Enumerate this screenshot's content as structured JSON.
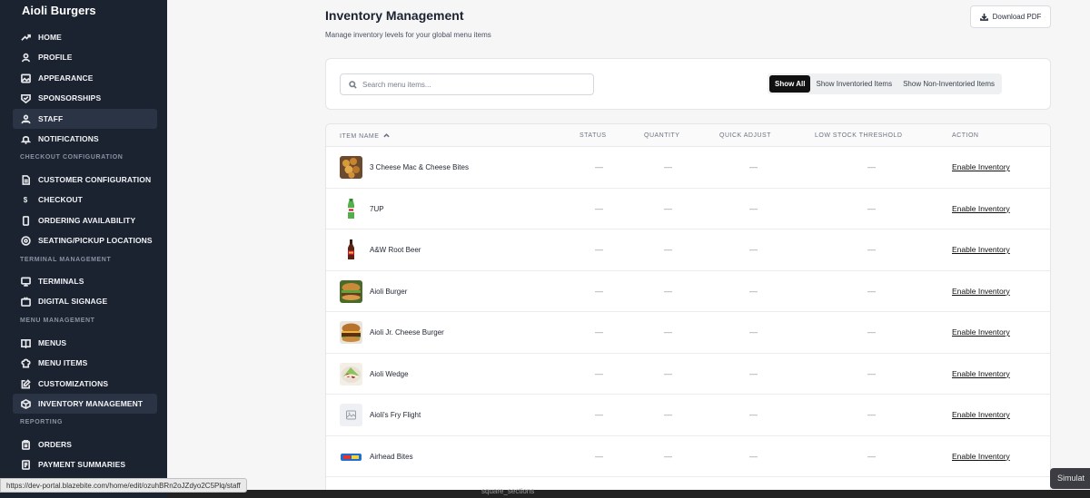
{
  "sidebar": {
    "brand": "Aioli Burgers",
    "items": [
      {
        "label": "HOME",
        "icon": "trend-icon"
      },
      {
        "label": "PROFILE",
        "icon": "user-icon"
      },
      {
        "label": "APPEARANCE",
        "icon": "image-icon"
      },
      {
        "label": "SPONSORSHIPS",
        "icon": "badge-icon"
      },
      {
        "label": "STAFF",
        "icon": "users-icon"
      },
      {
        "label": "NOTIFICATIONS",
        "icon": "bell-icon"
      },
      {
        "label": "CUSTOMER CONFIGURATION",
        "icon": "file-icon"
      },
      {
        "label": "CHECKOUT",
        "icon": "dollar-icon"
      },
      {
        "label": "ORDERING AVAILABILITY",
        "icon": "phone-icon"
      },
      {
        "label": "SEATING/PICKUP LOCATIONS",
        "icon": "location-icon"
      },
      {
        "label": "TERMINALS",
        "icon": "monitor-icon"
      },
      {
        "label": "DIGITAL SIGNAGE",
        "icon": "tv-icon"
      },
      {
        "label": "MENUS",
        "icon": "book-icon"
      },
      {
        "label": "MENU ITEMS",
        "icon": "chef-hat-icon"
      },
      {
        "label": "CUSTOMIZATIONS",
        "icon": "edit-icon"
      },
      {
        "label": "INVENTORY MANAGEMENT",
        "icon": "box-icon"
      },
      {
        "label": "ORDERS",
        "icon": "clipboard-icon"
      },
      {
        "label": "PAYMENT SUMMARIES",
        "icon": "receipt-icon"
      }
    ],
    "active_index": 4,
    "highlight_index": 15,
    "sections": {
      "checkout": "CHECKOUT CONFIGURATION",
      "terminal": "TERMINAL MANAGEMENT",
      "menu": "MENU MANAGEMENT",
      "reporting": "REPORTING"
    }
  },
  "header": {
    "title": "Inventory Management",
    "subtitle": "Manage inventory levels for your global menu items",
    "download_label": "Download PDF"
  },
  "filters": {
    "search_placeholder": "Search menu items...",
    "search_value": "",
    "tabs": [
      "Show All",
      "Show Inventoried Items",
      "Show Non-Inventoried Items"
    ],
    "active_tab": 0
  },
  "table": {
    "columns": [
      "ITEM NAME",
      "STATUS",
      "QUANTITY",
      "QUICK ADJUST",
      "LOW STOCK THRESHOLD",
      "ACTION"
    ],
    "rows": [
      {
        "name": "3 Cheese Mac & Cheese Bites",
        "status": "—",
        "quantity": "—",
        "quick_adjust": "—",
        "threshold": "—",
        "action": "Enable Inventory",
        "thumb": "mac-cheese-photo"
      },
      {
        "name": "7UP",
        "status": "—",
        "quantity": "—",
        "quick_adjust": "—",
        "threshold": "—",
        "action": "Enable Inventory",
        "thumb": "soda-bottle-photo"
      },
      {
        "name": "A&W Root Beer",
        "status": "—",
        "quantity": "—",
        "quick_adjust": "—",
        "threshold": "—",
        "action": "Enable Inventory",
        "thumb": "root-beer-bottle-photo"
      },
      {
        "name": "Aioli Burger",
        "status": "—",
        "quantity": "—",
        "quick_adjust": "—",
        "threshold": "—",
        "action": "Enable Inventory",
        "thumb": "burger-photo"
      },
      {
        "name": "Aioli Jr. Cheese Burger",
        "status": "—",
        "quantity": "—",
        "quick_adjust": "—",
        "threshold": "—",
        "action": "Enable Inventory",
        "thumb": "cheeseburger-photo"
      },
      {
        "name": "Aioli Wedge",
        "status": "—",
        "quantity": "—",
        "quick_adjust": "—",
        "threshold": "—",
        "action": "Enable Inventory",
        "thumb": "wedge-salad-photo"
      },
      {
        "name": "Aioli's Fry Flight",
        "status": "—",
        "quantity": "—",
        "quick_adjust": "—",
        "threshold": "—",
        "action": "Enable Inventory",
        "thumb": "image-placeholder-icon"
      },
      {
        "name": "Airhead Bites",
        "status": "—",
        "quantity": "—",
        "quick_adjust": "—",
        "threshold": "—",
        "action": "Enable Inventory",
        "thumb": "candy-bag-photo"
      }
    ]
  },
  "statusbar": {
    "url": "https://dev-portal.blazebite.com/home/edit/ozuhBRn2oJZdyo2C5Plq/staff"
  },
  "footer": {
    "partial_text": "square_sections",
    "simulator_tab": "Simulat"
  }
}
